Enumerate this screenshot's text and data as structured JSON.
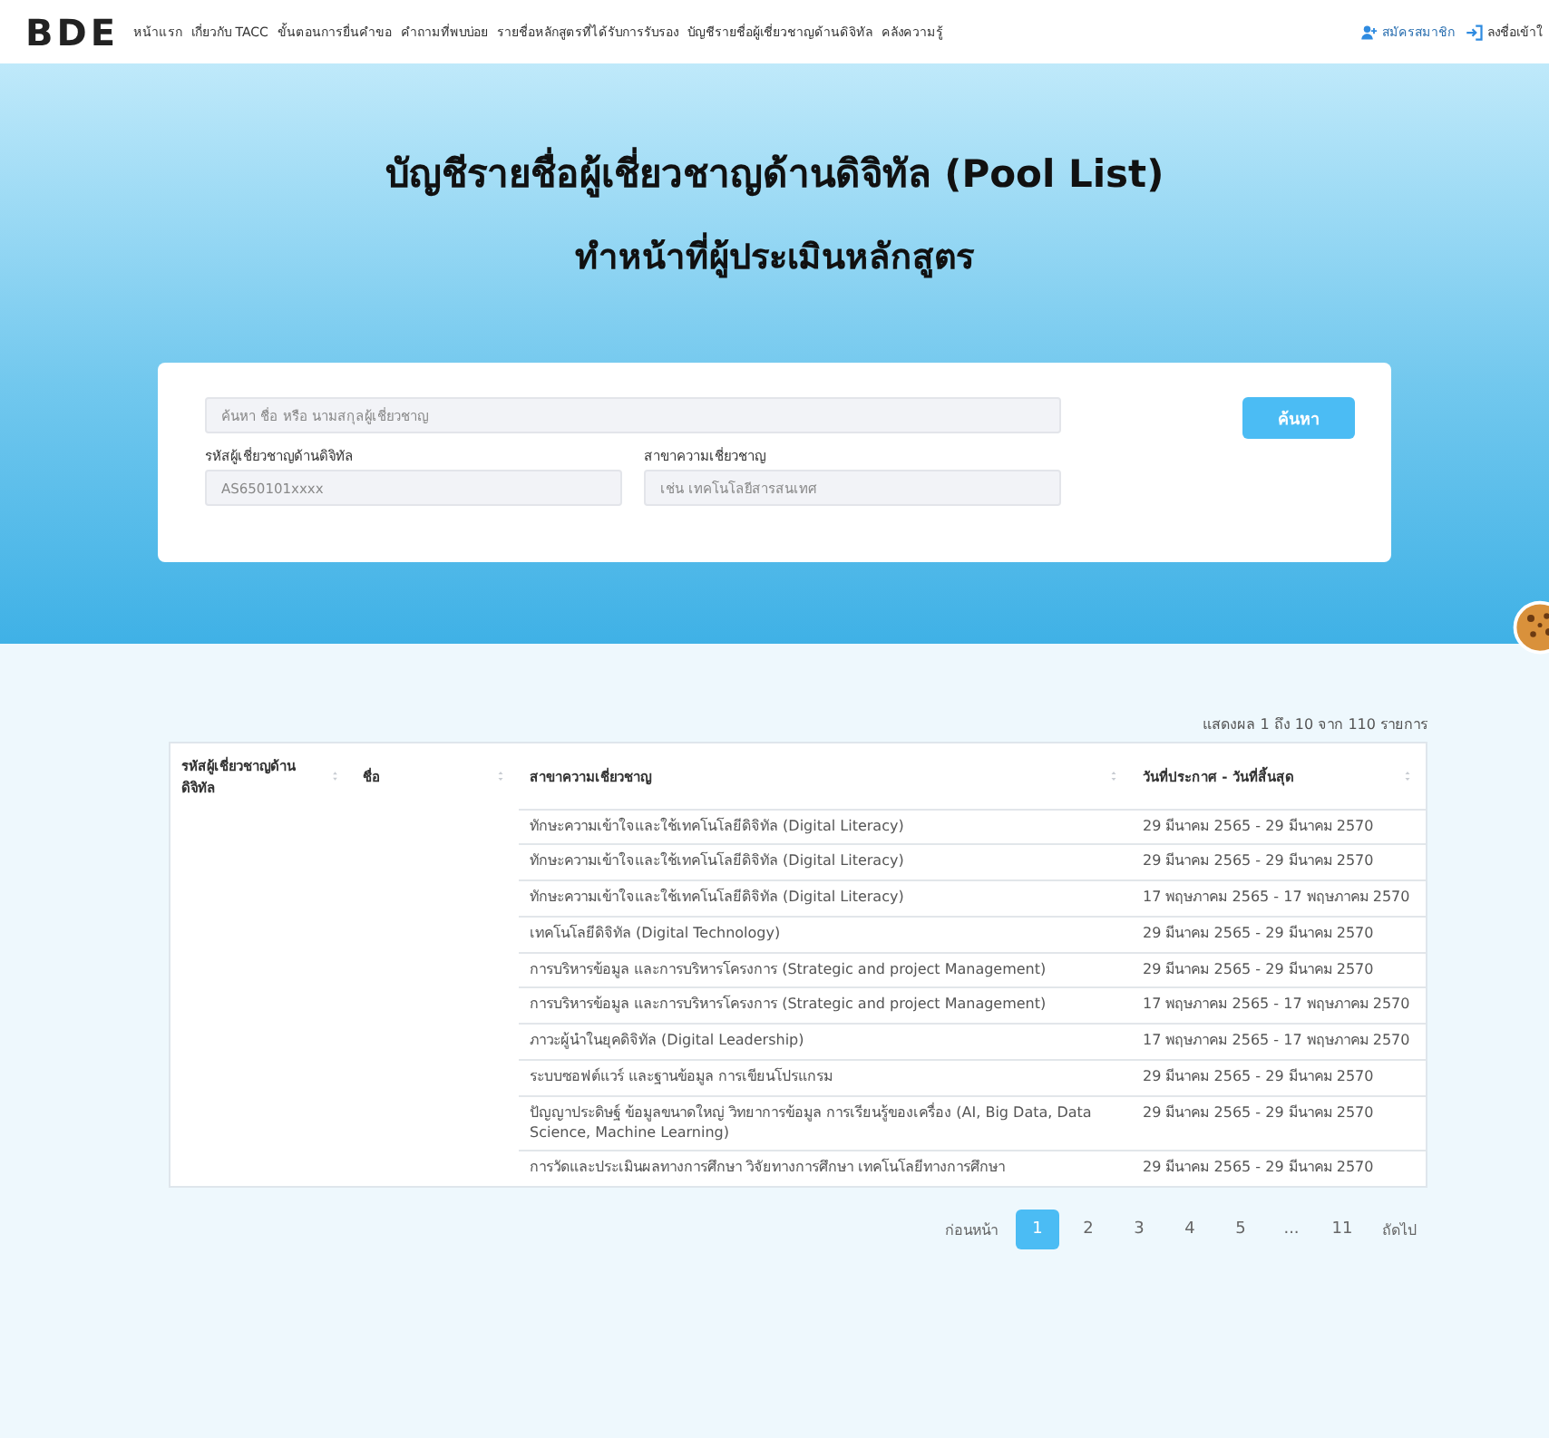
{
  "header": {
    "logo": "BDE",
    "nav": [
      {
        "label": "หน้าแรก"
      },
      {
        "label": "เกี่ยวกับ TACC"
      },
      {
        "label": "ขั้นตอนการยื่นคำขอ"
      },
      {
        "label": "คำถามที่พบบ่อย"
      },
      {
        "label": "รายชื่อหลักสูตรที่ได้รับการรับรอง"
      },
      {
        "label": "บัญชีรายชื่อผู้เชี่ยวชาญด้านดิจิทัล"
      },
      {
        "label": "คลังความรู้"
      }
    ],
    "actions": [
      {
        "kind": "register",
        "label": "สมัครสมาชิก"
      },
      {
        "kind": "login",
        "label": "ลงชื่อเข้าใ"
      }
    ]
  },
  "hero": {
    "title": "บัญชีรายชื่อผู้เชี่ยวชาญด้านดิจิทัล (Pool List)",
    "subtitle": "ทำหน้าที่ผู้ประเมินหลักสูตร"
  },
  "search": {
    "keyword": {
      "placeholder": "ค้นหา ชื่อ หรือ นามสกุลผู้เชี่ยวชาญ"
    },
    "button": "ค้นหา",
    "filters": [
      {
        "label": "รหัสผู้เชี่ยวชาญด้านดิจิทัล",
        "placeholder": "AS650101xxxx"
      },
      {
        "label": "สาขาความเชี่ยวชาญ",
        "placeholder": "เช่น เทคโนโลยีสารสนเทศ"
      }
    ]
  },
  "table": {
    "info": "แสดงผล 1 ถึง 10 จาก 110 รายการ",
    "columns": [
      "รหัสผู้เชี่ยวชาญด้านดิจิทัล",
      "ชื่อ",
      "สาขาความเชี่ยวชาญ",
      "วันที่ประกาศ - วันที่สิ้นสุด"
    ],
    "rows": [
      {
        "expertise": "ทักษะความเข้าใจและใช้เทคโนโลยีดิจิทัล (Digital Literacy)",
        "period": "29 มีนาคม 2565 - 29 มีนาคม 2570"
      },
      {
        "expertise": "ทักษะความเข้าใจและใช้เทคโนโลยีดิจิทัล (Digital Literacy)",
        "period": "29 มีนาคม 2565 - 29 มีนาคม 2570"
      },
      {
        "expertise": "ทักษะความเข้าใจและใช้เทคโนโลยีดิจิทัล (Digital Literacy)",
        "period": "17 พฤษภาคม 2565 - 17 พฤษภาคม 2570"
      },
      {
        "expertise": "เทคโนโลยีดิจิทัล (Digital Technology)",
        "period": "29 มีนาคม 2565 - 29 มีนาคม 2570"
      },
      {
        "expertise": "การบริหารข้อมูล และการบริหารโครงการ (Strategic and project Management)",
        "period": "29 มีนาคม 2565 - 29 มีนาคม 2570"
      },
      {
        "expertise": "การบริหารข้อมูล และการบริหารโครงการ (Strategic and project Management)",
        "period": "17 พฤษภาคม 2565 - 17 พฤษภาคม 2570"
      },
      {
        "expertise": "ภาวะผู้นำในยุคดิจิทัล (Digital Leadership)",
        "period": "17 พฤษภาคม 2565 - 17 พฤษภาคม 2570"
      },
      {
        "expertise": "ระบบซอฟต์แวร์ และฐานข้อมูล การเขียนโปรแกรม",
        "period": "29 มีนาคม 2565 - 29 มีนาคม 2570"
      },
      {
        "expertise": "ปัญญาประดิษฐ์ ข้อมูลขนาดใหญ่ วิทยาการข้อมูล การเรียนรู้ของเครื่อง (AI, Big Data, Data Science, Machine Learning)",
        "period": "29 มีนาคม 2565 - 29 มีนาคม 2570"
      },
      {
        "expertise": "การวัดและประเมินผลทางการศึกษา วิจัยทางการศึกษา เทคโนโลยีทางการศึกษา",
        "period": "29 มีนาคม 2565 - 29 มีนาคม 2570"
      }
    ]
  },
  "pagination": {
    "prev": "ก่อนหน้า",
    "next": "ถัดไป",
    "pages": [
      {
        "label": "1",
        "selected": true
      },
      {
        "label": "2",
        "selected": false
      },
      {
        "label": "3",
        "selected": false
      },
      {
        "label": "4",
        "selected": false
      },
      {
        "label": "5",
        "selected": false
      },
      {
        "label": "...",
        "selected": false
      },
      {
        "label": "11",
        "selected": false
      }
    ]
  }
}
